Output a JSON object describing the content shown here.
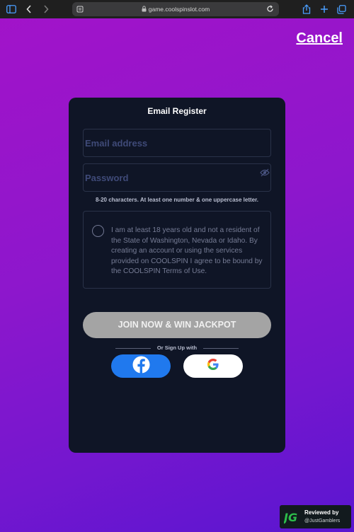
{
  "browser": {
    "url": "game.coolspinslot.com",
    "icons": [
      "sidebar-icon",
      "back-icon",
      "forward-icon",
      "reader-icon",
      "lock-icon",
      "reload-icon",
      "share-icon",
      "new-tab-icon",
      "tabs-icon"
    ]
  },
  "header": {
    "cancel_label": "Cancel"
  },
  "register": {
    "title": "Email Register",
    "email_placeholder": "Email address",
    "password_placeholder": "Password",
    "password_hint": "8-20 characters. At least one number & one uppercase letter.",
    "terms_text": "I am at least 18 years old and not a resident of the State of Washington, Nevada or Idaho. By creating an account or using the services provided on COOLSPIN I agree to be bound by the COOLSPIN Terms of Use.",
    "join_label": "JOIN NOW & WIN JACKPOT",
    "divider_label": "Or Sign Up with",
    "social": [
      "facebook-icon",
      "google-icon"
    ]
  },
  "badge": {
    "title": "Reviewed by",
    "handle": "@JustGamblers",
    "logo_text": "JG"
  },
  "colors": {
    "background_start": "#a313c9",
    "background_end": "#5a15d0",
    "card": "#0f1526",
    "join_button": "#a4a4a4",
    "facebook": "#2079ee"
  }
}
